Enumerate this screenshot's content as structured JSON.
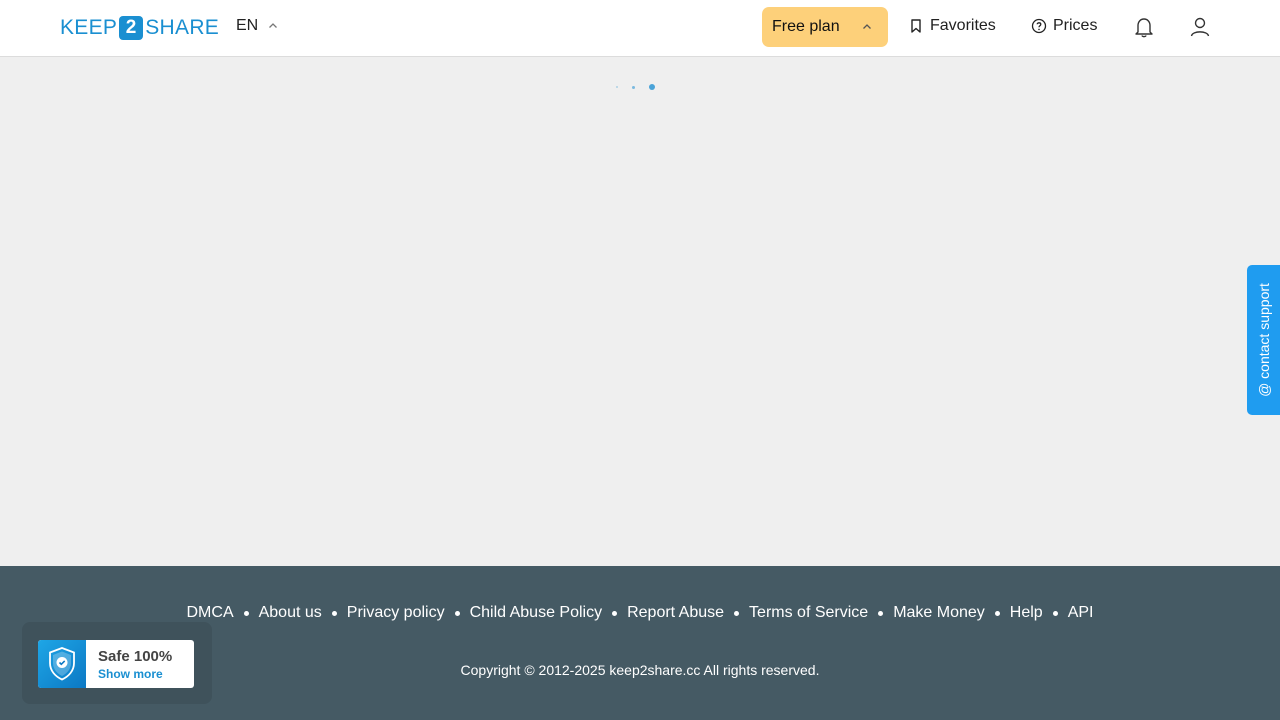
{
  "header": {
    "logo_left": "KEEP",
    "logo_mid": "2",
    "logo_right": "SHARE",
    "language": "EN",
    "plan_button": "Free plan",
    "favorites": "Favorites",
    "prices": "Prices"
  },
  "support_tab": {
    "label": "@ contact support"
  },
  "footer": {
    "links": [
      "DMCA",
      "About us",
      "Privacy policy",
      "Child Abuse Policy",
      "Report Abuse",
      "Terms of Service",
      "Make Money",
      "Help",
      "API"
    ],
    "copyright": "Copyright © 2012-2025 keep2share.cc All rights reserved."
  },
  "safe_badge": {
    "title": "Safe 100%",
    "more": "Show more"
  },
  "colors": {
    "brand": "#1a8fd1",
    "plan_button_bg": "#fdd07a",
    "footer_bg": "#455a64",
    "support_tab_bg": "#1f9cf0",
    "page_bg": "#efefef"
  },
  "icons": [
    "chevron-up-icon",
    "bookmark-icon",
    "help-circle-icon",
    "bell-icon",
    "user-icon",
    "shield-check-icon"
  ]
}
